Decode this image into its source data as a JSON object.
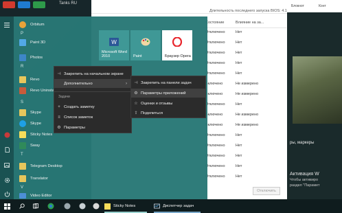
{
  "desktop": {
    "top_icon_label": "Tanks RU"
  },
  "task_manager": {
    "bios_text": "Длительность последнего запуска BIOS: 4.1 с",
    "columns": [
      "Состояние",
      "Влияние на за..."
    ],
    "rows": [
      {
        "state": "Отключено",
        "impact": "Нет"
      },
      {
        "state": "Отключено",
        "impact": "Нет"
      },
      {
        "state": "Отключено",
        "impact": "Нет"
      },
      {
        "state": "Отключено",
        "impact": "Нет"
      },
      {
        "state": "Отключено",
        "impact": "Нет"
      },
      {
        "state": "Включено",
        "impact": "Не измерено"
      },
      {
        "state": "Включено",
        "impact": "Не измерено"
      },
      {
        "state": "Отключено",
        "impact": "Нет"
      },
      {
        "state": "Включено",
        "impact": "Не измерено"
      },
      {
        "state": "Включено",
        "impact": "Не измерено"
      },
      {
        "state": "Отключено",
        "impact": "Нет"
      },
      {
        "state": "Отключено",
        "impact": "Нет"
      },
      {
        "state": "Отключено",
        "impact": "Нет"
      },
      {
        "state": "Отключено",
        "impact": "Нет"
      },
      {
        "state": "Отключено",
        "impact": "Нет"
      }
    ],
    "disable_button": "Отключить"
  },
  "side_pane": {
    "top_labels": [
      "Блокнот",
      "Конт"
    ],
    "caption": "ры, маркеры",
    "activate_title": "Активация W",
    "activate_line1": "Чтобы активиро",
    "activate_line2": "раздел \"Парамет"
  },
  "start_menu": {
    "letters": {
      "p": "P",
      "r": "R",
      "s": "S",
      "t": "T",
      "v": "V"
    },
    "apps": {
      "orbitum": "Orbitum",
      "paint3d": "Paint 3D",
      "photos": "Photos",
      "revo": "Revo",
      "revo_uninstaller": "Revo Uninstal",
      "skype_folder": "Skype",
      "skype": "Skype",
      "sticky_notes": "Sticky Notes",
      "sway": "Sway",
      "telegram": "Telegram Desktop",
      "translator": "Translator",
      "video_editor": "Video Editor"
    },
    "tiles": {
      "word": "Microsoft Word 2010",
      "paint": "Paint",
      "opera": "Браузер Opera"
    }
  },
  "context_menu": {
    "pin_start": "Закрепить на начальном экране",
    "more": "Дополнительно",
    "tasks_header": "Задачи",
    "create_note": "Создать заметку",
    "notes_list": "Список заметок",
    "settings": "Параметры"
  },
  "submenu": {
    "pin_taskbar": "Закрепить на панели задач",
    "app_settings": "Параметры приложений",
    "rate_review": "Оценки и отзывы",
    "share": "Поделиться"
  },
  "taskbar": {
    "sticky_notes": "Sticky Notes",
    "task_manager": "Диспетчер задач"
  },
  "colors": {
    "start_bg": "#287876",
    "tile_bg": "#3f9896",
    "menu_bg": "#2b2b2b"
  }
}
